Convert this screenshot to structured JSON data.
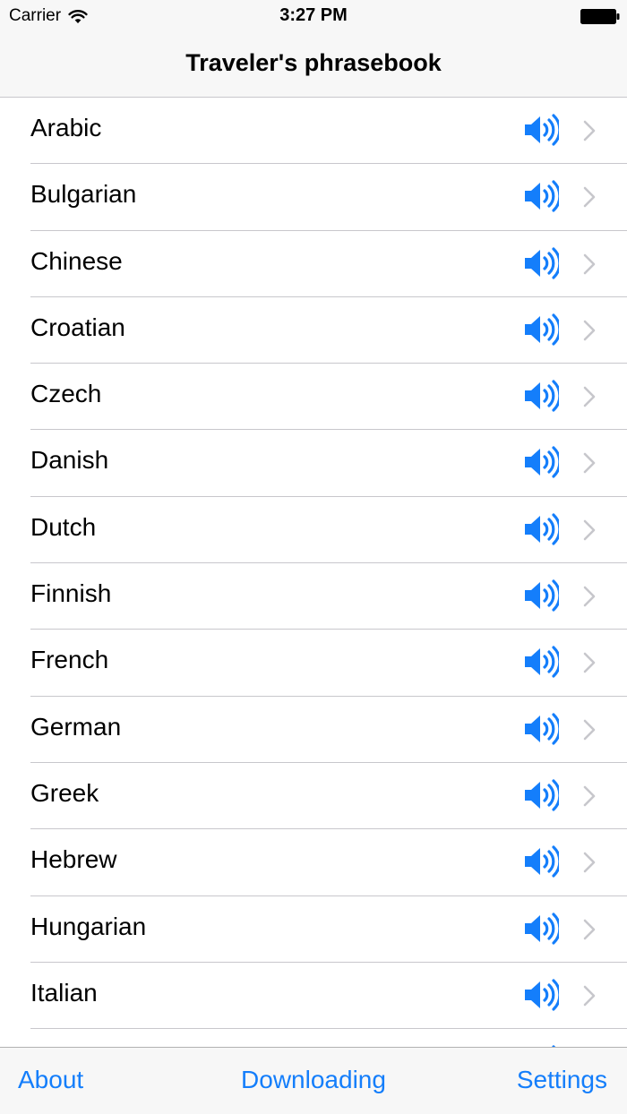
{
  "status_bar": {
    "carrier": "Carrier",
    "time": "3:27 PM"
  },
  "nav": {
    "title": "Traveler's phrasebook"
  },
  "languages": [
    {
      "label": "Arabic"
    },
    {
      "label": "Bulgarian"
    },
    {
      "label": "Chinese"
    },
    {
      "label": "Croatian"
    },
    {
      "label": "Czech"
    },
    {
      "label": "Danish"
    },
    {
      "label": "Dutch"
    },
    {
      "label": "Finnish"
    },
    {
      "label": "French"
    },
    {
      "label": "German"
    },
    {
      "label": "Greek"
    },
    {
      "label": "Hebrew"
    },
    {
      "label": "Hungarian"
    },
    {
      "label": "Italian"
    },
    {
      "label": ""
    }
  ],
  "tabs": {
    "about": "About",
    "downloading": "Downloading",
    "settings": "Settings"
  },
  "colors": {
    "accent": "#147efb",
    "chevron": "#c7c7cc",
    "separator": "#c8c7cc"
  },
  "icons": {
    "row_action": "speaker-icon",
    "row_disclosure": "chevron-right-icon"
  }
}
